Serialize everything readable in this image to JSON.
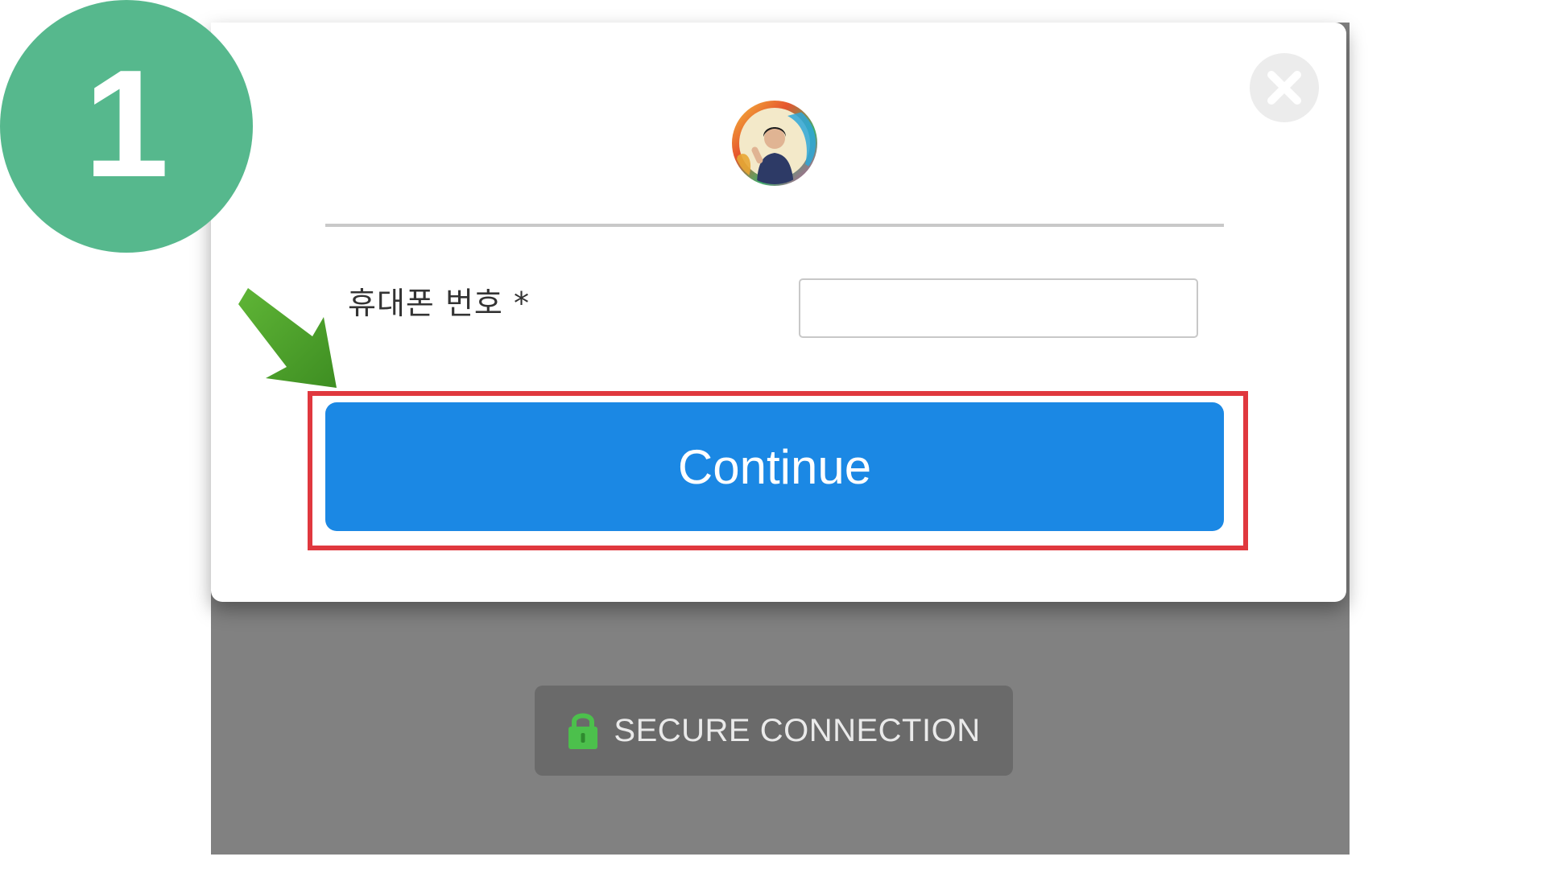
{
  "step_badge": {
    "number": "1"
  },
  "modal": {
    "close_icon": "close-circle-icon",
    "logo_icon": "profile-avatar-logo",
    "form": {
      "phone_label": "휴대폰 번호 *",
      "phone_value": "",
      "phone_placeholder": ""
    },
    "continue_label": "Continue"
  },
  "footer": {
    "secure_icon": "lock-icon",
    "secure_label": "SECURE CONNECTION"
  },
  "annotations": {
    "arrow_icon": "green-pointer-arrow",
    "highlight_color": "#e0383e"
  },
  "colors": {
    "accent": "#1b88e4",
    "step_badge": "#56b88d",
    "lock_green": "#4cc04c",
    "overlay": "#818181"
  }
}
